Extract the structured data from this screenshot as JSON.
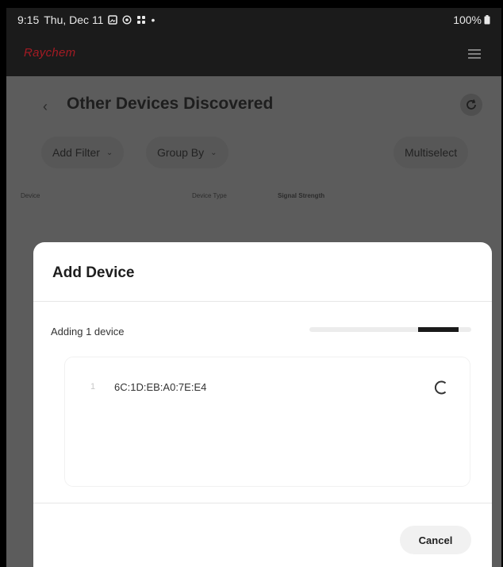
{
  "status_bar": {
    "time": "9:15",
    "date": "Thu, Dec 11",
    "dot": "•",
    "battery": "100%"
  },
  "app": {
    "brand": "Raychem",
    "accent_color": "#a41b23"
  },
  "header": {
    "title": "Other Devices Discovered",
    "back_icon": "chevron-left-icon",
    "refresh_icon": "refresh-icon"
  },
  "filters": {
    "add_filter": "Add Filter",
    "group_by": "Group By",
    "multiselect": "Multiselect"
  },
  "columns": {
    "device": "Device",
    "device_type": "Device Type",
    "signal_strength": "Signal Strength"
  },
  "dialog": {
    "title": "Add Device",
    "adding_text": "Adding 1 device",
    "progress_fraction": 0.25,
    "devices": [
      {
        "index": "1",
        "mac": "6C:1D:EB:A0:7E:E4"
      }
    ],
    "cancel_label": "Cancel"
  }
}
